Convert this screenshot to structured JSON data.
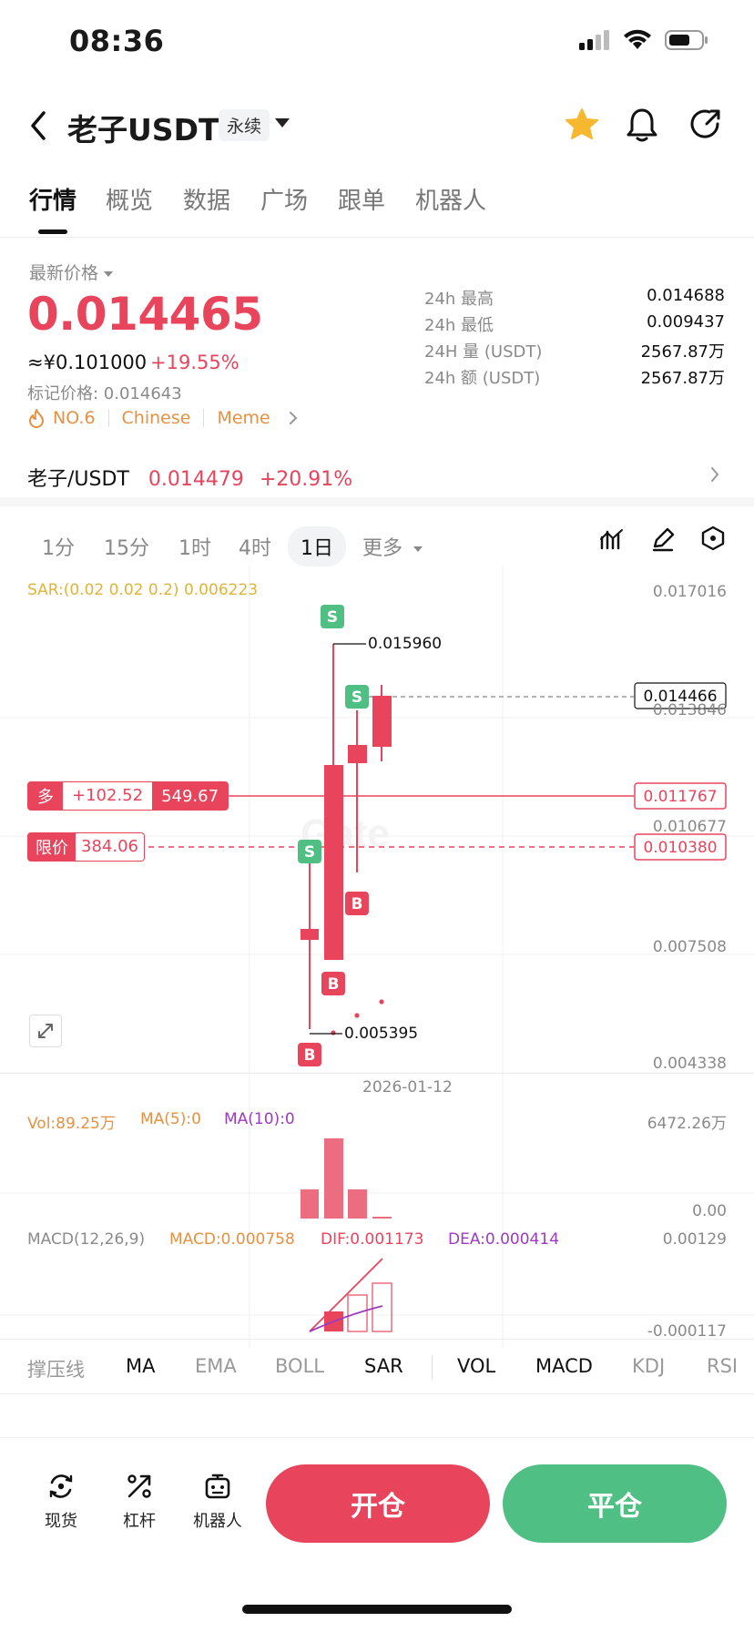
{
  "status_bar": {
    "time": "08:36"
  },
  "header": {
    "title": "老子USDT",
    "contract_type": "永续"
  },
  "tabs": [
    "行情",
    "概览",
    "数据",
    "广场",
    "跟单",
    "机器人"
  ],
  "price": {
    "latest_label": "最新价格",
    "last": "0.014465",
    "cny": "≈¥0.101000",
    "change": "+19.55%",
    "mark": "标记价格: 0.014643"
  },
  "tags": [
    "NO.6",
    "Chinese",
    "Meme"
  ],
  "stats": [
    {
      "label": "24h  最高",
      "value": "0.014688"
    },
    {
      "label": "24h  最低",
      "value": "0.009437"
    },
    {
      "label": "24H  量 (USDT)",
      "value": "2567.87万"
    },
    {
      "label": "24h  额 (USDT)",
      "value": "2567.87万"
    }
  ],
  "spot_pair": {
    "name": "老子/USDT",
    "price": "0.014479",
    "change": "+20.91%"
  },
  "timeframes": [
    "1分",
    "15分",
    "1时",
    "4时",
    "1日",
    "更多"
  ],
  "active_timeframe": "1日",
  "chart": {
    "sar_label": "SAR:(0.02 0.02 0.2) 0.006223",
    "y_labels": [
      "0.017016",
      "0.013846",
      "0.010677",
      "0.007508",
      "0.004338"
    ],
    "high_label": "0.015960",
    "low_label": "0.005395",
    "current_price_tag": "0.014466",
    "position": {
      "side": "多",
      "pnl": "+102.52",
      "size": "549.67",
      "price": "0.011767"
    },
    "limit_order": {
      "label": "限价",
      "size": "384.06",
      "price": "0.010380"
    },
    "date": "2026-01-12",
    "marker_s": "S",
    "marker_b": "B"
  },
  "volume": {
    "vol": "Vol:89.25万",
    "ma5": "MA(5):0",
    "ma10": "MA(10):0",
    "y_top": "6472.26万",
    "y_bottom": "0.00"
  },
  "macd": {
    "label": "MACD(12,26,9)",
    "macd": "MACD:0.000758",
    "dif": "DIF:0.001173",
    "dea": "DEA:0.000414",
    "y_top": "0.00129",
    "y_bottom": "-0.000117"
  },
  "indicators": [
    "撑压线",
    "MA",
    "EMA",
    "BOLL",
    "SAR",
    "VOL",
    "MACD",
    "KDJ",
    "RSI"
  ],
  "bottom_nav": {
    "spot": "现货",
    "leverage": "杠杆",
    "bot": "机器人",
    "open": "开仓",
    "close": "平仓"
  },
  "colors": {
    "red": "#e8455c",
    "green": "#4fbf84",
    "accent_gold": "#f5b82e"
  }
}
